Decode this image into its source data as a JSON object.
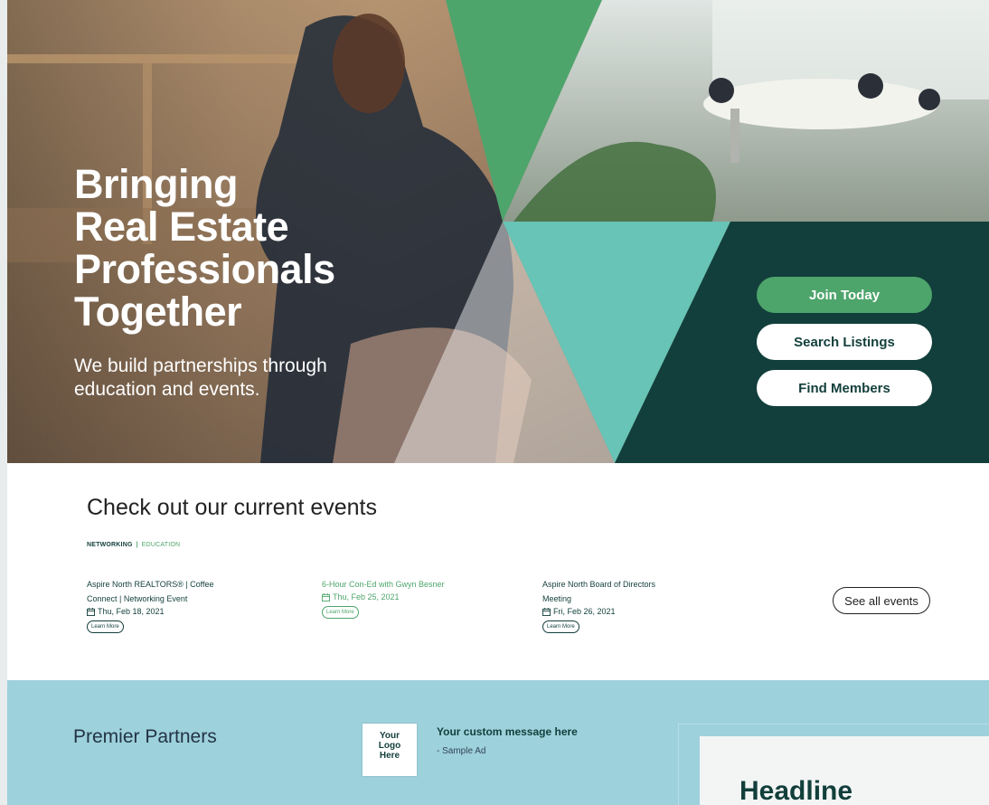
{
  "hero": {
    "title_lines": [
      "Bringing",
      "Real Estate",
      "Professionals",
      "Together"
    ],
    "subtitle": "We build partnerships through education and events.",
    "cta": {
      "join": "Join Today",
      "search": "Search Listings",
      "find": "Find Members"
    }
  },
  "events": {
    "heading": "Check out our current events",
    "tabs": [
      "NETWORKING",
      "|",
      "EDUCATION"
    ],
    "items": [
      {
        "title": "Aspire North REALTORS® | Coffee Connect | Networking Event",
        "date": "Thu, Feb 18, 2021",
        "button": "Learn More"
      },
      {
        "title": "6-Hour Con-Ed with Gwyn Besner",
        "date": "Thu, Feb 25, 2021",
        "button": "Learn More"
      },
      {
        "title": "Aspire North Board of Directors Meeting",
        "date": "Fri, Feb 26, 2021",
        "button": "Learn More"
      }
    ],
    "see_all": "See all events"
  },
  "partners": {
    "heading": "Premier Partners",
    "logo_text": [
      "Your",
      "Logo",
      "Here"
    ],
    "ad_title": "Your custom message here",
    "ad_sub": "- Sample Ad",
    "card_headline": "Headline"
  },
  "colors": {
    "dark_teal": "#123f3b",
    "green": "#4ea56c",
    "light_teal": "#67c4b6",
    "partners_bg": "#9dd1dc"
  },
  "icons": [
    "calendar-icon"
  ]
}
